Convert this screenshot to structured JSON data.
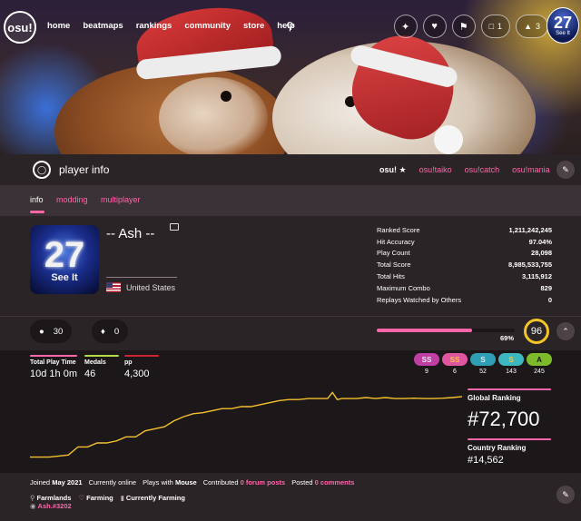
{
  "nav": {
    "logo": "osu!",
    "links": [
      "home",
      "beatmaps",
      "rankings",
      "community",
      "store",
      "help"
    ],
    "chat_count": "1",
    "notification_count": "3"
  },
  "user_avatar": {
    "number": "27",
    "caption": "See It"
  },
  "profile_header": {
    "title": "player info",
    "modes": [
      "osu!",
      "osu!taiko",
      "osu!catch",
      "osu!mania"
    ],
    "active_mode": "osu!"
  },
  "subtabs": [
    "info",
    "modding",
    "multiplayer"
  ],
  "profile": {
    "username": "-- Ash --",
    "country": "United States"
  },
  "stats": [
    {
      "label": "Ranked Score",
      "value": "1,211,242,245"
    },
    {
      "label": "Hit Accuracy",
      "value": "97.04%"
    },
    {
      "label": "Play Count",
      "value": "28,098"
    },
    {
      "label": "Total Score",
      "value": "8,985,533,755"
    },
    {
      "label": "Total Hits",
      "value": "3,115,912"
    },
    {
      "label": "Maximum Combo",
      "value": "829"
    },
    {
      "label": "Replays Watched by Others",
      "value": "0"
    }
  ],
  "followers": "30",
  "mapping_subscribers": "0",
  "level": {
    "value": "96",
    "progress_label": "69%",
    "progress": 0.69
  },
  "summary": [
    {
      "label": "Total Play Time",
      "value": "10d 1h 0m",
      "color": "#ff66aa"
    },
    {
      "label": "Medals",
      "value": "46",
      "color": "#b3d944"
    },
    {
      "label": "pp",
      "value": "4,300",
      "color": "#cc2233"
    }
  ],
  "grades": [
    {
      "label": "SS",
      "count": "9",
      "bg": "#bf3ea3",
      "fg": "#e8e8e8"
    },
    {
      "label": "SS",
      "count": "6",
      "bg": "#e0559f",
      "fg": "#f5c542"
    },
    {
      "label": "S",
      "count": "52",
      "bg": "#2f9fb5",
      "fg": "#e8e8e8"
    },
    {
      "label": "S",
      "count": "143",
      "bg": "#3eb8bf",
      "fg": "#f5c542"
    },
    {
      "label": "A",
      "count": "245",
      "bg": "#7dbb2a",
      "fg": "#1c1719"
    }
  ],
  "ranking": {
    "global_label": "Global Ranking",
    "global": "#72,700",
    "country_label": "Country Ranking",
    "country": "#14,562"
  },
  "chart_data": {
    "type": "line",
    "x": [
      0,
      4,
      8,
      10,
      12,
      14,
      16,
      18,
      20,
      22,
      24,
      26,
      28,
      30,
      32,
      34,
      36,
      38,
      40,
      42,
      44,
      46,
      48,
      50,
      52,
      54,
      56,
      58,
      60,
      62,
      63,
      64,
      65,
      66,
      68,
      70,
      72,
      74,
      76,
      78,
      80,
      82,
      84,
      86,
      88,
      90
    ],
    "values": [
      400,
      400,
      390,
      350,
      350,
      330,
      330,
      320,
      300,
      300,
      270,
      260,
      250,
      220,
      200,
      185,
      180,
      170,
      160,
      160,
      150,
      150,
      140,
      130,
      120,
      115,
      115,
      110,
      110,
      110,
      80,
      115,
      110,
      110,
      110,
      105,
      110,
      105,
      110,
      110,
      108,
      110,
      110,
      108,
      105,
      100
    ],
    "ylim": [
      60,
      420
    ],
    "color": "#f5c02d"
  },
  "footer": {
    "joined_label": "Joined",
    "joined_value": "May 2021",
    "online_status": "Currently online",
    "plays_with_label": "Plays with",
    "plays_with_value": "Mouse",
    "contributed_label": "Contributed",
    "contributed_value": "0 forum posts",
    "posted_label": "Posted",
    "posted_value": "0 comments",
    "location": "Farmlands",
    "interests": "Farming",
    "occupation": "Currently Farming",
    "discord": "Ash.#3202"
  }
}
